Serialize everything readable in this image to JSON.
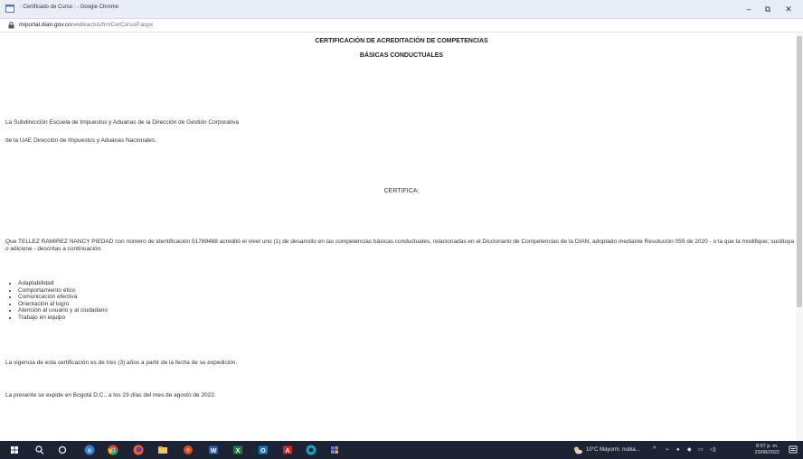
{
  "window": {
    "title": ": Certificado de Curso : - Google Chrome",
    "controls": {
      "minimize": "–",
      "restore": "⧉",
      "close": "✕"
    }
  },
  "address": {
    "host": "miportal.dian.gov.co",
    "path": "/webkactus/frmCerCursoP.aspx"
  },
  "document": {
    "heading1": "CERTIFICACIÓN DE ACREDITACIÓN DE COMPETENCIAS",
    "heading2": "BÁSICAS CONDUCTUALES",
    "intro_line1": "La Subdirección Escuela de Impuestos y Aduanas de la Dirección de Gestión Corporativa",
    "intro_line2": "de la UAE Dirección de Impuestos y Aduanas Nacionales.",
    "certifica": "CERTIFICA:",
    "body": "Que TELLEZ RAMIREZ NANCY PIEDAD con número de identificación 51789488 acreditó el nivel uno (1) de desarrollo en las competencias básicas conductuales, relacionadas en el Diccionario de Competencias de la DIAN, adoptado mediante Resolución 059 de 2020 - o la que la modifique, sustituya o adicione - descritas a continuación:",
    "competencies": [
      "Adaptabilidad",
      "Comportamiento ético",
      "Comunicación efectiva",
      "Orientación al logro",
      "Atención al usuario y al ciudadano",
      "Trabajo en equipo"
    ],
    "validity": "La vigencia de esta certificación es de tres (3) años a partir de la fecha de su expedición.",
    "issued": "La presente se expide en Bogotá D.C., a los 23 días del mes de agosto de 2022."
  },
  "taskbar": {
    "weather": "10°C Mayorm. nubla...",
    "time": "8:57 p. m.",
    "date": "23/08/2022",
    "icons": [
      "windows-start-icon",
      "search-icon",
      "task-view-icon",
      "edge-icon",
      "chrome-icon",
      "firefox-icon",
      "file-explorer-icon",
      "app-icon",
      "word-icon",
      "excel-icon",
      "outlook-icon",
      "acrobat-icon",
      "edge-dev-icon",
      "teams-icon"
    ]
  },
  "colors": {
    "taskbar": "#1c2433",
    "titlebar": "#e9eef6"
  }
}
